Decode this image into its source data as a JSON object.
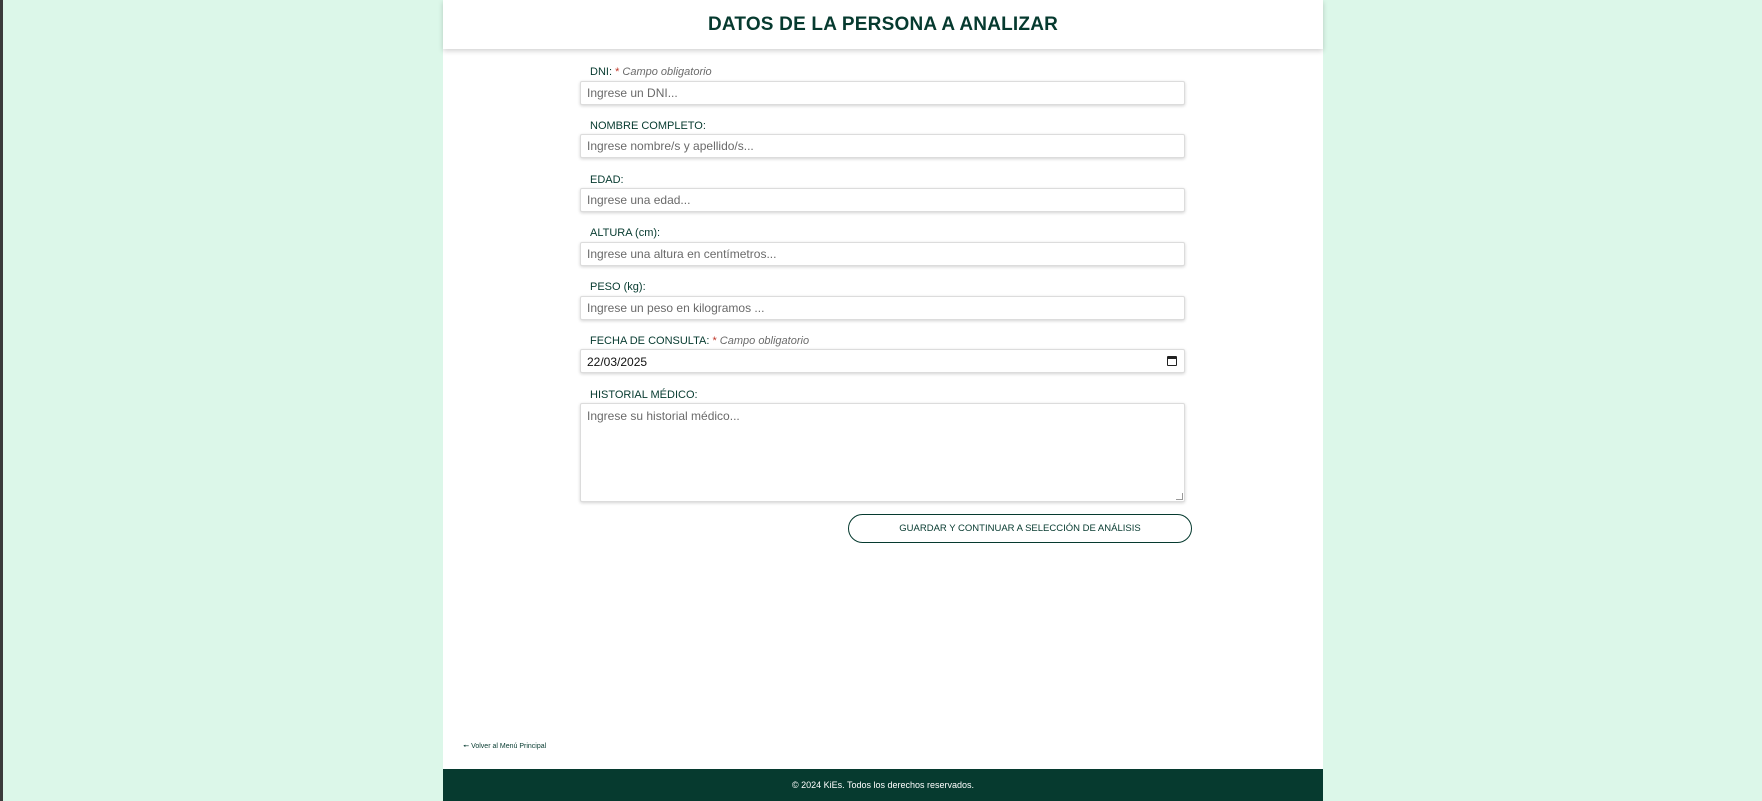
{
  "header": {
    "title": "DATOS DE LA PERSONA A ANALIZAR"
  },
  "form": {
    "required_marker": "*",
    "required_note": "Campo obligatorio",
    "dni": {
      "label": "DNI:",
      "placeholder": "Ingrese un DNI..."
    },
    "nombre": {
      "label": "NOMBRE COMPLETO:",
      "placeholder": "Ingrese nombre/s y apellido/s..."
    },
    "edad": {
      "label": "EDAD:",
      "placeholder": "Ingrese una edad..."
    },
    "altura": {
      "label": "ALTURA (cm):",
      "placeholder": "Ingrese una altura en centímetros..."
    },
    "peso": {
      "label": "PESO (kg):",
      "placeholder": "Ingrese un peso en kilogramos ..."
    },
    "fecha": {
      "label": "FECHA DE CONSULTA:",
      "value": "22/03/2025"
    },
    "historial": {
      "label": "HISTORIAL MÉDICO:",
      "placeholder": "Ingrese su historial médico..."
    },
    "submit_label": "GUARDAR Y CONTINUAR A SELECCIÓN DE ANÁLISIS"
  },
  "back_link": {
    "label": "🠔 Volver al Menú Principal"
  },
  "footer": {
    "text": "© 2024 KiEs. Todos los derechos reservados."
  },
  "colors": {
    "background": "#dcf7e9",
    "brand_dark_green": "#063a2f",
    "required_red": "#c0392b"
  },
  "icons": {
    "date_picker": "calendar-icon",
    "back_arrow": "arrow-left-icon"
  }
}
